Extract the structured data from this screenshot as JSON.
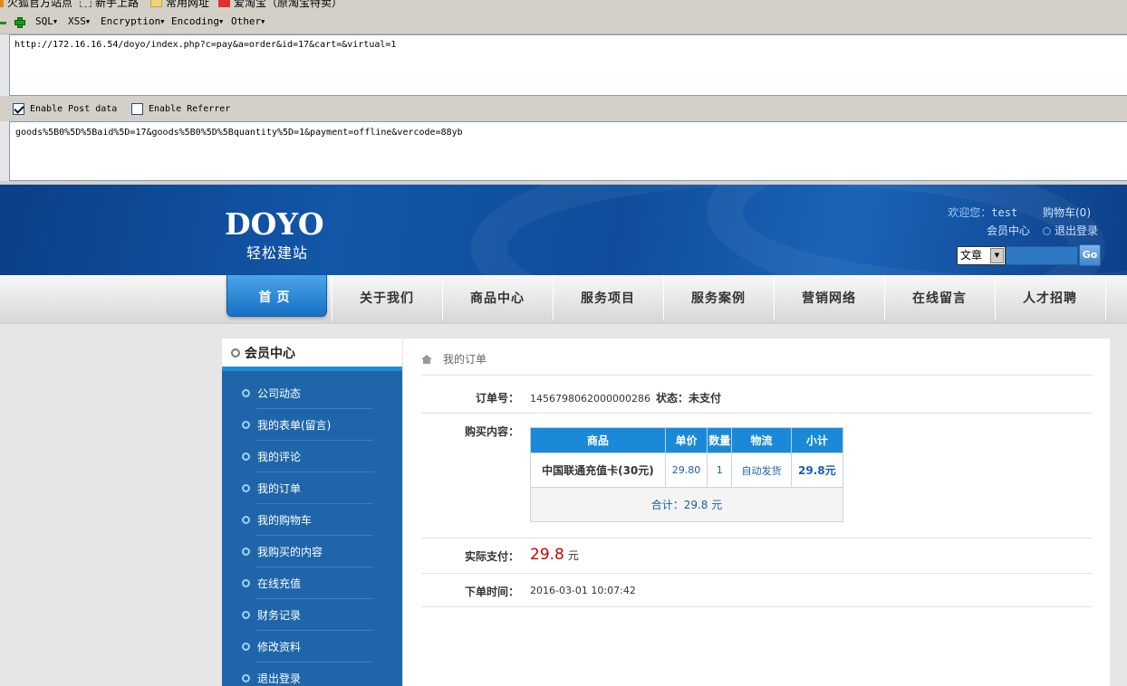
{
  "bookmarks": [
    "火狐官方站点",
    "新手上路",
    "常用网址",
    "爱淘宝（原淘宝特卖）"
  ],
  "hackbar": {
    "menu": [
      "SQL",
      "XSS",
      "Encryption",
      "Encoding",
      "Other"
    ],
    "url": "http://172.16.16.54/doyo/index.php?c=pay&a=order&id=17&cart=&virtual=1",
    "enable_post_label": "Enable Post data",
    "enable_referrer_label": "Enable Referrer",
    "enable_post_checked": true,
    "enable_referrer_checked": false,
    "post_data": "goods%5B0%5D%5Baid%5D=17&goods%5B0%5D%5Bquantity%5D=1&payment=offline&vercode=88yb"
  },
  "header": {
    "logo_word": "DOYO",
    "logo_sub": "轻松建站",
    "welcome": "欢迎您：",
    "username": "test",
    "cart": "购物车(0)",
    "member_center": "会员中心",
    "logout": "退出登录",
    "search_select": "文章",
    "search_go": "Go"
  },
  "nav": [
    "首页",
    "关于我们",
    "商品中心",
    "服务项目",
    "服务案例",
    "营销网络",
    "在线留言",
    "人才招聘"
  ],
  "sidebar": {
    "title": "会员中心",
    "items": [
      "公司动态",
      "我的表单(留言)",
      "我的评论",
      "我的订单",
      "我的购物车",
      "我购买的内容",
      "在线充值",
      "财务记录",
      "修改资料",
      "退出登录"
    ]
  },
  "content": {
    "breadcrumb": "我的订单",
    "order_no_label": "订单号：",
    "order_no": "1456798062000000286",
    "status": "状态：未支付",
    "purchase_label": "购买内容：",
    "table": {
      "headers": [
        "商品",
        "单价",
        "数量",
        "物流",
        "小计"
      ],
      "rows": [
        {
          "name": "中国联通充值卡(30元)",
          "price": "29.80",
          "qty": "1",
          "logistics": "自动发货",
          "subtotal": "29.8元"
        }
      ],
      "total": "合计：29.8 元"
    },
    "actual_pay_label": "实际支付：",
    "actual_pay_amount": "29.8",
    "actual_pay_unit": "元",
    "order_time_label": "下单时间：",
    "order_time": "2016-03-01 10:07:42"
  }
}
